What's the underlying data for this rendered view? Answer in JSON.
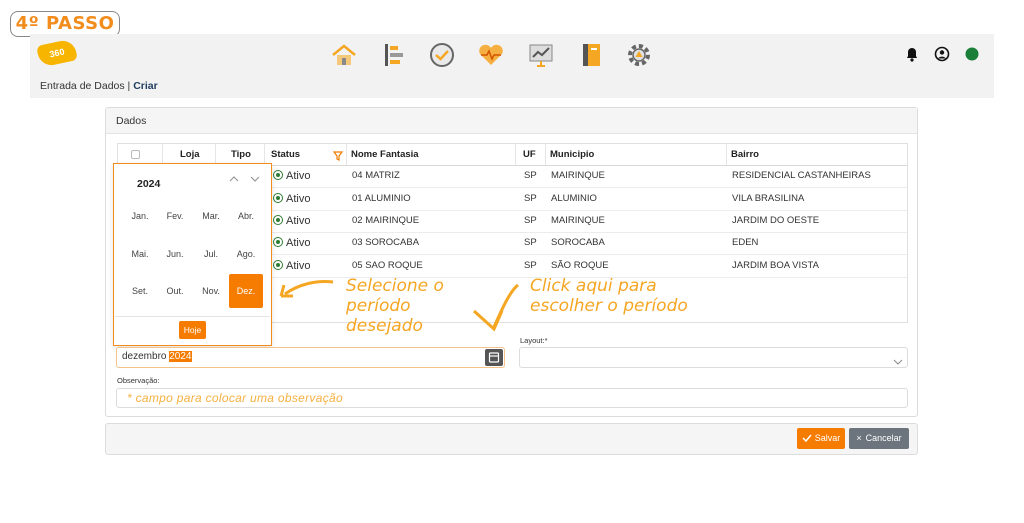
{
  "step_badge": "4º PASSO",
  "logo_text": "360",
  "breadcrumb": {
    "section": "Entrada de Dados |",
    "current": "Criar"
  },
  "panel_title": "Dados",
  "table": {
    "headers": [
      "Loja",
      "Tipo",
      "Status",
      "Nome Fantasia",
      "UF",
      "Municipio",
      "Bairro"
    ],
    "rows": [
      {
        "status": "Ativo",
        "nome": "04 MATRIZ",
        "uf": "SP",
        "municipio": "MAIRINQUE",
        "bairro": "RESIDENCIAL CASTANHEIRAS"
      },
      {
        "status": "Ativo",
        "nome": "01 ALUMINIO",
        "uf": "SP",
        "municipio": "ALUMINIO",
        "bairro": "VILA BRASILINA"
      },
      {
        "status": "Ativo",
        "nome": "02 MAIRINQUE",
        "uf": "SP",
        "municipio": "MAIRINQUE",
        "bairro": "JARDIM DO OESTE"
      },
      {
        "status": "Ativo",
        "nome": "03 SOROCABA",
        "uf": "SP",
        "municipio": "SOROCABA",
        "bairro": "EDEN"
      },
      {
        "status": "Ativo",
        "nome": "05 SAO ROQUE",
        "uf": "SP",
        "municipio": "SÃO ROQUE",
        "bairro": "JARDIM BOA VISTA"
      }
    ]
  },
  "picker": {
    "year": "2024",
    "months": [
      "Jan.",
      "Fev.",
      "Mar.",
      "Abr.",
      "Mai.",
      "Jun.",
      "Jul.",
      "Ago.",
      "Set.",
      "Out.",
      "Nov.",
      "Dez."
    ],
    "selected_month": "Dez.",
    "today_button": "Hoje"
  },
  "annotations": {
    "select_period": [
      "Selecione o",
      "período",
      "desejado"
    ],
    "click_here": [
      "Click aqui para",
      "escolher o período"
    ]
  },
  "form": {
    "period_month": "dezembro",
    "period_year": "2024",
    "layout_label": "Layout:*",
    "obs_label": "Observação:",
    "obs_placeholder": "* campo para colocar uma observação"
  },
  "buttons": {
    "save": "Salvar",
    "cancel": "Cancelar"
  },
  "colors": {
    "accent": "#f57c00",
    "annotation": "#f5a623",
    "status_green": "#2e7d32"
  }
}
